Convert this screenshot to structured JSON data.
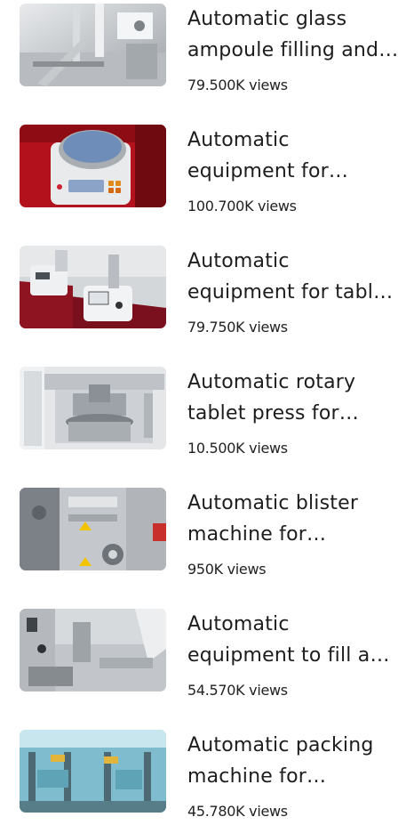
{
  "videos": [
    {
      "title": "Automatic glass ampoule filling and sealing machine",
      "views": "79.500K views",
      "thumbnail_icon": "ampoule-filling-machine-photo"
    },
    {
      "title": "Automatic equipment for electronic weighing",
      "views": "100.700K views",
      "thumbnail_icon": "electronic-scale-photo"
    },
    {
      "title": "Automatic equipment for tablet hardness testing",
      "views": "79.750K views",
      "thumbnail_icon": "hardness-tester-photo"
    },
    {
      "title": "Automatic rotary tablet press for pharmaceutical use",
      "views": "10.500K views",
      "thumbnail_icon": "rotary-tablet-press-photo"
    },
    {
      "title": "Automatic blister machine for packaging",
      "views": "950K views",
      "thumbnail_icon": "blister-machine-photo"
    },
    {
      "title": "Automatic equipment to fill and seal",
      "views": "54.570K views",
      "thumbnail_icon": "filling-equipment-photo"
    },
    {
      "title": "Automatic packing machine for production line",
      "views": "45.780K views",
      "thumbnail_icon": "packing-machine-photo"
    }
  ]
}
